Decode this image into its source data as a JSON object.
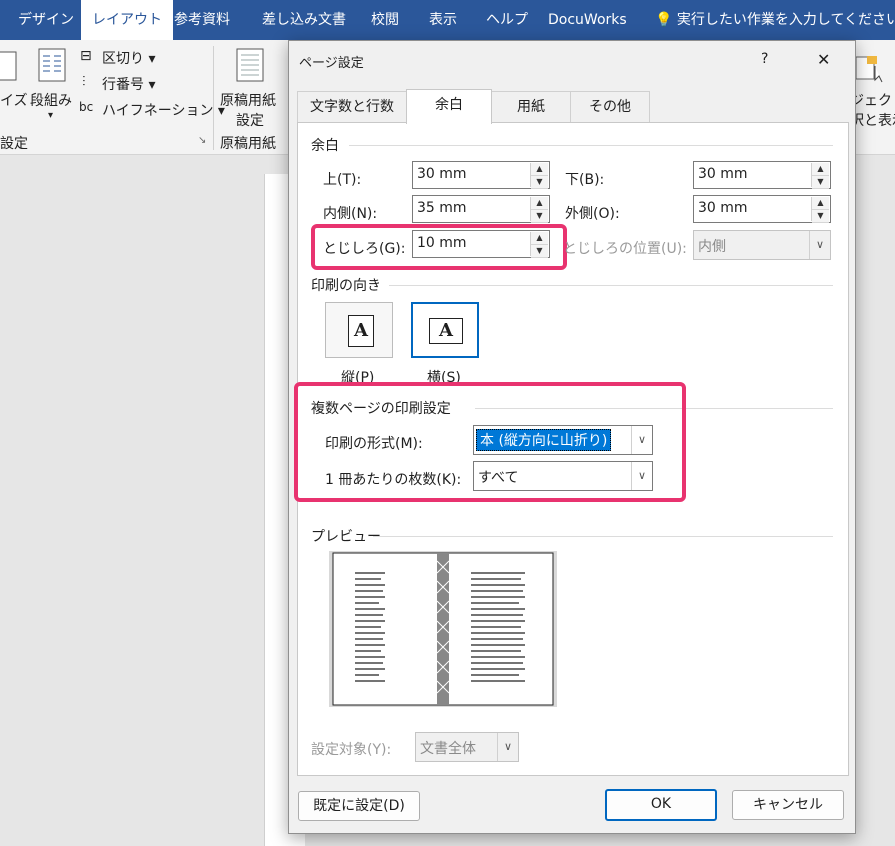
{
  "ribbon_tabs": [
    "デザイン",
    "レイアウト",
    "参考資料",
    "差し込み文書",
    "校閲",
    "表示",
    "ヘルプ",
    "DocuWorks"
  ],
  "tell_me": "実行したい作業を入力してください",
  "ribbon": {
    "size_label": "イズ",
    "columns_label": "段組み",
    "breaks_label": "区切り",
    "line_numbers_label": "行番号",
    "hyphenation_label": "ハイフネーション",
    "manuscript_label_1": "原稿用紙",
    "manuscript_label_2": "設定",
    "group_page_setup": "設定",
    "group_manuscript": "原稿用紙",
    "right_label_1": "ジェクト",
    "right_label_2": "択と表示"
  },
  "dialog": {
    "title": "ページ設定",
    "help": "?",
    "close": "✕",
    "tabs": [
      "文字数と行数",
      "余白",
      "用紙",
      "その他"
    ],
    "margins_group": "余白",
    "top_label": "上(T):",
    "top_value": "30 mm",
    "bottom_label": "下(B):",
    "bottom_value": "30 mm",
    "inside_label": "内側(N):",
    "inside_value": "35 mm",
    "outside_label": "外側(O):",
    "outside_value": "30 mm",
    "gutter_label": "とじしろ(G):",
    "gutter_value": "10 mm",
    "gutter_pos_label": "とじしろの位置(U):",
    "gutter_pos_value": "内側",
    "orientation_group": "印刷の向き",
    "portrait_label": "縦(P)",
    "landscape_label": "横(S)",
    "multipage_group": "複数ページの印刷設定",
    "print_format_label": "印刷の形式(M):",
    "print_format_value": "本 (縦方向に山折り)",
    "sheets_label": "1 冊あたりの枚数(K):",
    "sheets_value": "すべて",
    "preview_group": "プレビュー",
    "apply_to_label": "設定対象(Y):",
    "apply_to_value": "文書全体",
    "default_button": "既定に設定(D)",
    "ok_button": "OK",
    "cancel_button": "キャンセル"
  },
  "colors": {
    "ribbon_blue": "#2b579a",
    "highlight": "#e8336f",
    "selection": "#0067c0"
  }
}
